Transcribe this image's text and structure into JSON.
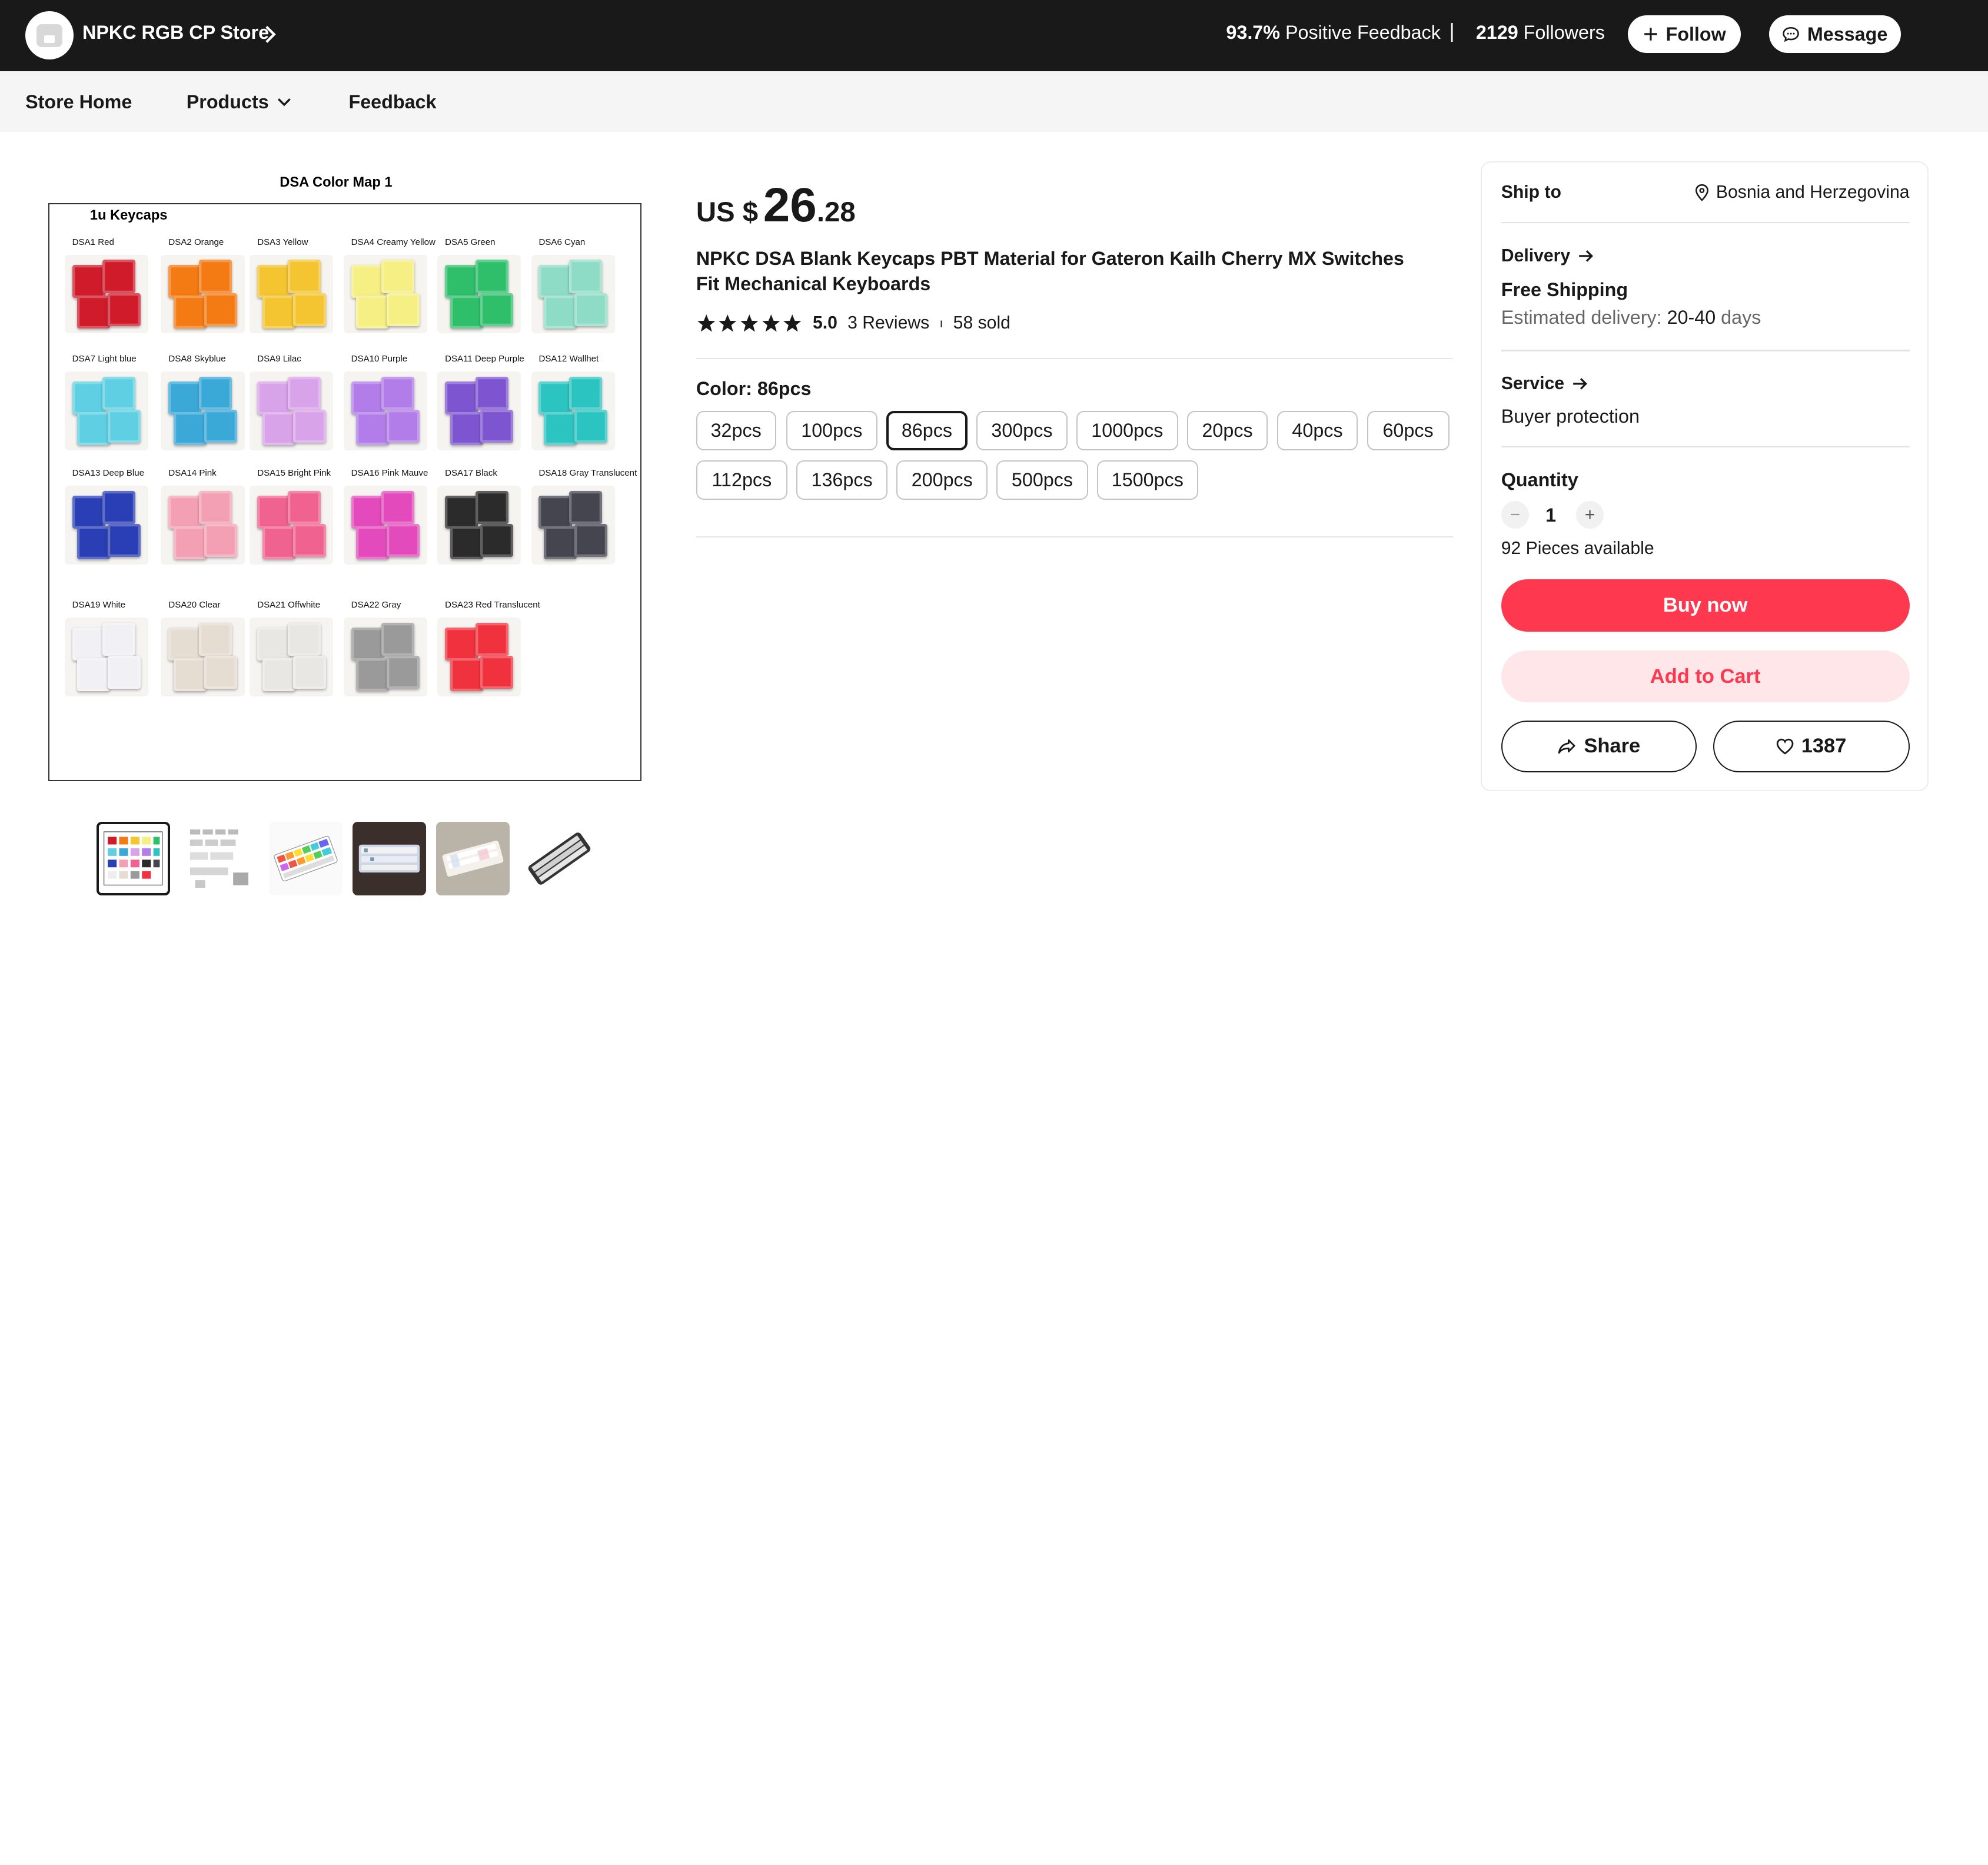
{
  "store": {
    "name": "NPKC RGB CP Store",
    "feedback_value": "93.7%",
    "feedback_label": "Positive Feedback",
    "separator": "|",
    "followers_value": "2129",
    "followers_label": "Followers",
    "follow_label": "Follow",
    "message_label": "Message"
  },
  "nav": {
    "items": [
      {
        "label": "Store Home"
      },
      {
        "label": "Products"
      },
      {
        "label": "Feedback"
      }
    ]
  },
  "gallery": {
    "image_title": "DSA Color Map 1",
    "image_subtitle": "1u Keycaps",
    "swatches": [
      {
        "label": "DSA1 Red",
        "color": "#d01b2b"
      },
      {
        "label": "DSA2 Orange",
        "color": "#f47a14"
      },
      {
        "label": "DSA3 Yellow",
        "color": "#f4c531"
      },
      {
        "label": "DSA4 Creamy Yellow",
        "color": "#f6ef83"
      },
      {
        "label": "DSA5 Green",
        "color": "#2fbf6b"
      },
      {
        "label": "DSA6  Cyan",
        "color": "#8fdcc6"
      },
      {
        "label": "DSA7  Light blue",
        "color": "#5fd0e3"
      },
      {
        "label": "DSA8  Skyblue",
        "color": "#3aa9d8"
      },
      {
        "label": "DSA9   Lilac",
        "color": "#d9a3ea"
      },
      {
        "label": "DSA10  Purple",
        "color": "#b27de8"
      },
      {
        "label": "DSA11  Deep Purple",
        "color": "#7e55d0"
      },
      {
        "label": "DSA12  Wallhet",
        "color": "#2cc4c0"
      },
      {
        "label": "DSA13  Deep Blue",
        "color": "#2a3fb5"
      },
      {
        "label": "DSA14  Pink",
        "color": "#f4a0b4"
      },
      {
        "label": "DSA15  Bright Pink",
        "color": "#f0628f"
      },
      {
        "label": "DSA16  Pink Mauve",
        "color": "#e34bbd"
      },
      {
        "label": "DSA17  Black",
        "color": "#2b2b2b"
      },
      {
        "label": "DSA18  Gray Translucent",
        "color": "#454550"
      },
      {
        "label": "DSA19  White",
        "color": "#f1f0f4"
      },
      {
        "label": "DSA20  Clear",
        "color": "#e6ddd2"
      },
      {
        "label": "DSA21  Offwhite",
        "color": "#e8e7e3"
      },
      {
        "label": "DSA22  Gray",
        "color": "#9a9a9a"
      },
      {
        "label": "DSA23  Red Translucent",
        "color": "#f0323e"
      }
    ],
    "thumbnails": [
      {
        "name": "thumb-color-map"
      },
      {
        "name": "thumb-dimensions"
      },
      {
        "name": "thumb-rainbow-keyboard"
      },
      {
        "name": "thumb-white-keyboard-dark"
      },
      {
        "name": "thumb-white-keyboard-light"
      },
      {
        "name": "thumb-gray-keyboard"
      }
    ]
  },
  "product": {
    "currency": "US $",
    "price_int": "26",
    "price_dec": ".28",
    "title": "NPKC DSA Blank Keycaps PBT Material for Gateron Kailh Cherry MX Switches Fit Mechanical Keyboards",
    "rating": "5.0",
    "reviews": "3 Reviews",
    "rating_sep": "ı",
    "sold": "58 sold",
    "color_label": "Color: 86pcs",
    "options": [
      {
        "label": "32pcs"
      },
      {
        "label": "100pcs"
      },
      {
        "label": "86pcs",
        "selected": true
      },
      {
        "label": "300pcs"
      },
      {
        "label": "1000pcs"
      },
      {
        "label": "20pcs"
      },
      {
        "label": "40pcs"
      },
      {
        "label": "60pcs"
      },
      {
        "label": "112pcs"
      },
      {
        "label": "136pcs"
      },
      {
        "label": "200pcs"
      },
      {
        "label": "500pcs"
      },
      {
        "label": "1500pcs"
      }
    ]
  },
  "sidebar": {
    "ship_to_label": "Ship to",
    "ship_to_value": "Bosnia and Herzegovina",
    "delivery_label": "Delivery",
    "free_shipping": "Free Shipping",
    "estimated_prefix": "Estimated delivery: ",
    "estimated_range": "20-40",
    "estimated_suffix": " days",
    "service_label": "Service",
    "service_value": "Buyer protection",
    "quantity_label": "Quantity",
    "quantity_value": "1",
    "minus": "−",
    "plus": "+",
    "available": "92 Pieces available",
    "buy_now": "Buy now",
    "add_to_cart": "Add to Cart",
    "share": "Share",
    "wishlist_count": "1387"
  },
  "colors": {
    "accent": "#fd384f",
    "accent_light": "#ffe7e9",
    "topbar": "#191919"
  }
}
